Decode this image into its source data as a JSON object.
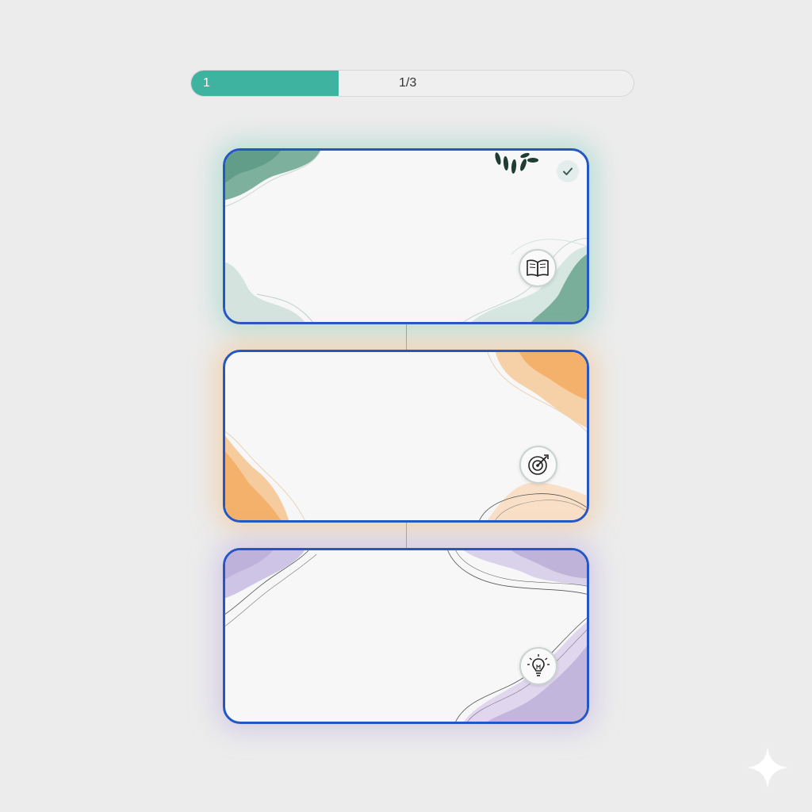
{
  "progress": {
    "step_label": "1",
    "count_label": "1/3",
    "fraction": 0.333,
    "fill_color": "#3db3a0"
  },
  "cards": [
    {
      "icon": "open-book-icon",
      "accent": "#6fa892",
      "completed": true
    },
    {
      "icon": "target-dart-icon",
      "accent": "#f2ab62",
      "completed": false
    },
    {
      "icon": "lightbulb-icon",
      "accent": "#b9abd6",
      "completed": false
    }
  ],
  "colors": {
    "card_border": "#2456c4",
    "background": "#ececec"
  }
}
